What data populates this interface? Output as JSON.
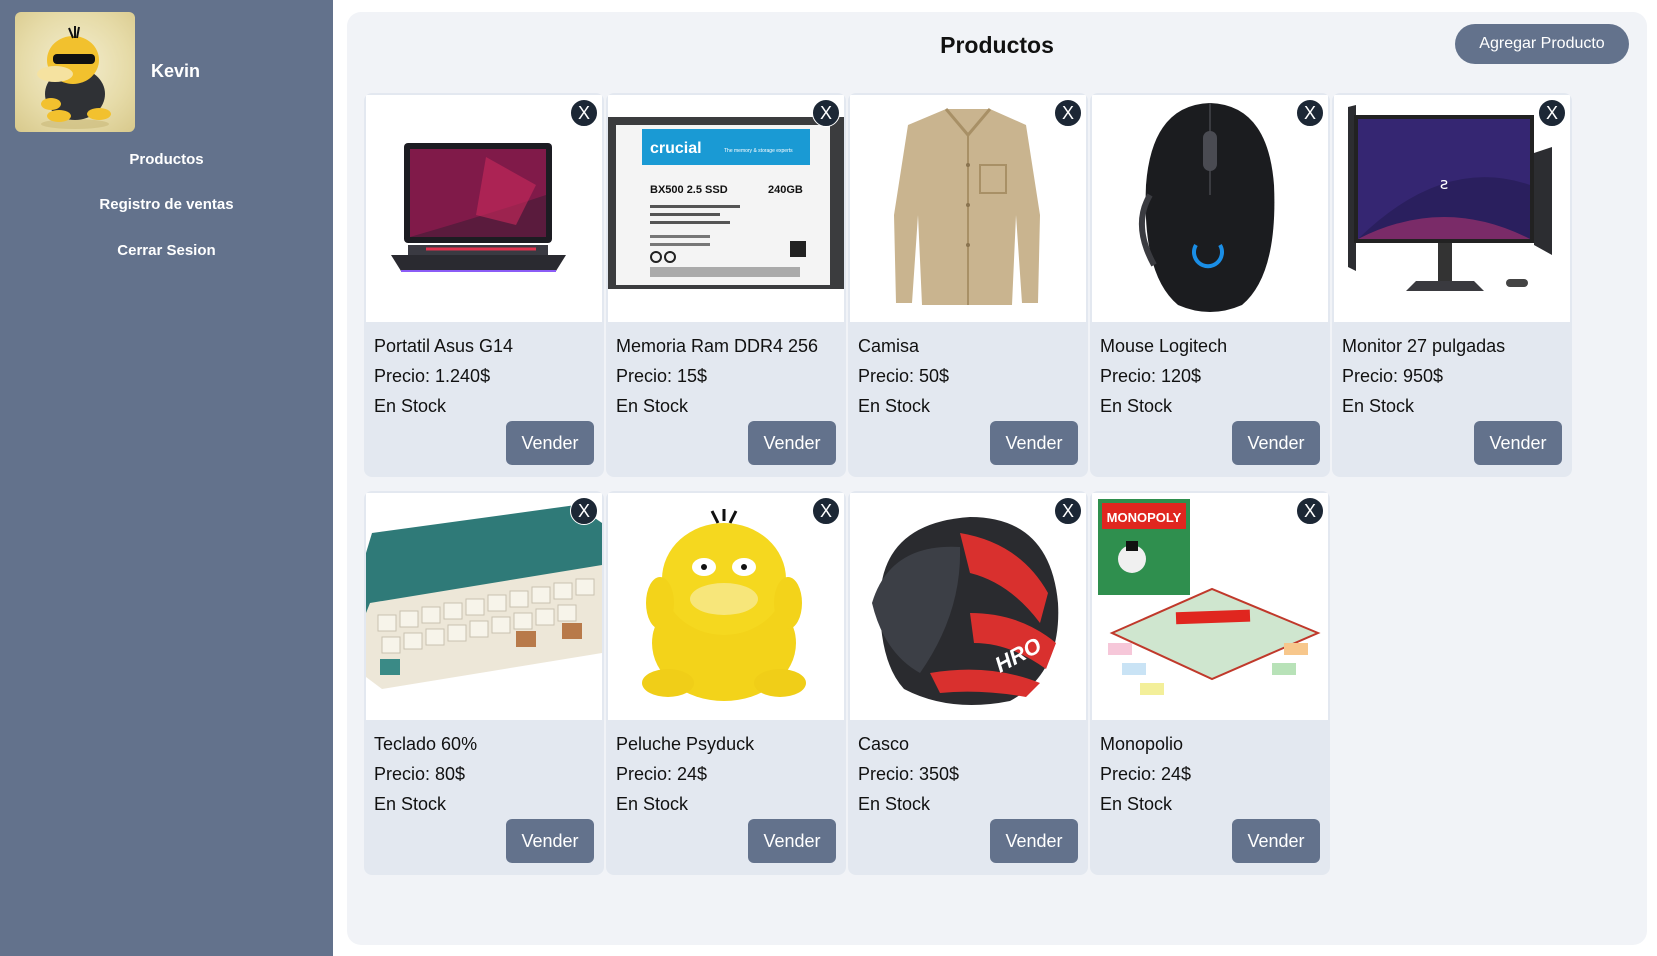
{
  "sidebar": {
    "user_name": "Kevin",
    "nav": [
      {
        "label": "Productos"
      },
      {
        "label": "Registro de ventas"
      },
      {
        "label": "Cerrar Sesion"
      }
    ]
  },
  "main": {
    "title": "Productos",
    "add_button_label": "Agregar Producto",
    "delete_symbol": "X",
    "sell_label": "Vender",
    "products": [
      {
        "name": "Portatil Asus G14",
        "price": "Precio: 1.240$",
        "stock": "En Stock",
        "image": "laptop-image"
      },
      {
        "name": "Memoria Ram DDR4 256",
        "price": "Precio: 15$",
        "stock": "En Stock",
        "image": "ssd-image"
      },
      {
        "name": "Camisa",
        "price": "Precio: 50$",
        "stock": "En Stock",
        "image": "shirt-image"
      },
      {
        "name": "Mouse Logitech",
        "price": "Precio: 120$",
        "stock": "En Stock",
        "image": "mouse-image"
      },
      {
        "name": "Monitor 27 pulgadas",
        "price": "Precio: 950$",
        "stock": "En Stock",
        "image": "monitor-image"
      },
      {
        "name": "Teclado 60%",
        "price": "Precio: 80$",
        "stock": "En Stock",
        "image": "keyboard-image"
      },
      {
        "name": "Peluche Psyduck",
        "price": "Precio: 24$",
        "stock": "En Stock",
        "image": "plush-image"
      },
      {
        "name": "Casco",
        "price": "Precio: 350$",
        "stock": "En Stock",
        "image": "helmet-image"
      },
      {
        "name": "Monopolio",
        "price": "Precio: 24$",
        "stock": "En Stock",
        "image": "boardgame-image"
      }
    ],
    "ssd_label": {
      "brand": "crucial",
      "tagline": "The memory & storage experts",
      "model": "BX500 2.5 SSD",
      "capacity": "240GB"
    },
    "boardgame_label": "MONOPOLY",
    "helmet_label": "HRO"
  },
  "colors": {
    "sidebar": "#63728c",
    "panel": "#f1f3f7",
    "card": "#e3e8f0",
    "button": "#63728c",
    "delete": "#1c2735"
  }
}
